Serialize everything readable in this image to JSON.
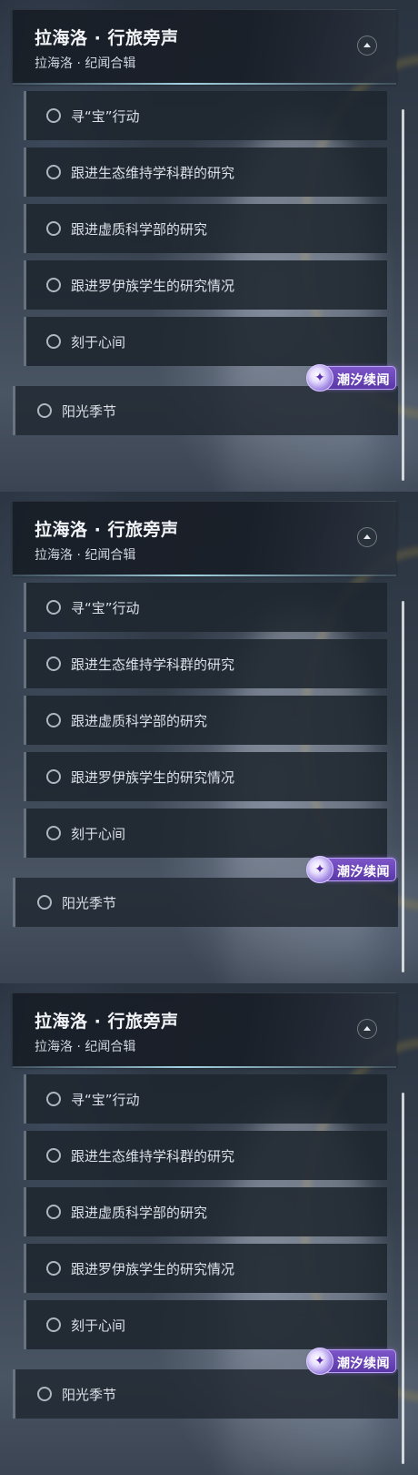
{
  "header": {
    "title": "拉海洛 · 行旅旁声",
    "subtitle": "拉海洛 · 纪闻合辑"
  },
  "items": [
    {
      "label": "寻“宝”行动"
    },
    {
      "label": "跟进生态维持学科群的研究"
    },
    {
      "label": "跟进虚质科学部的研究"
    },
    {
      "label": "跟进罗伊族学生的研究情况"
    },
    {
      "label": "刻于心间"
    },
    {
      "label": "阳光季节"
    }
  ],
  "badge": {
    "text": "潮汐续闻",
    "icon": "tide-swirl-icon"
  }
}
